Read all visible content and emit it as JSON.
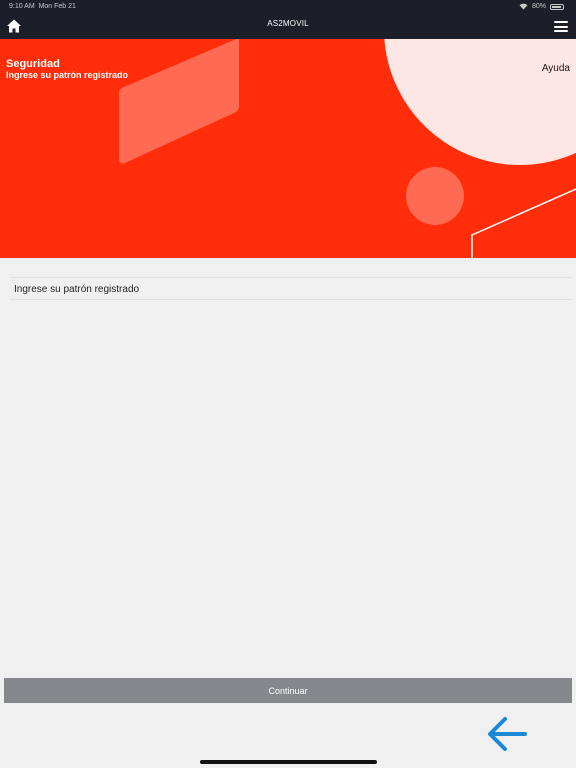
{
  "status_bar": {
    "time": "9:10 AM",
    "date": "Mon Feb 21",
    "battery": "80%",
    "wifi_icon": "wifi-icon",
    "battery_icon": "battery-icon"
  },
  "nav": {
    "title": "AS2MOVIL",
    "home_icon": "home-icon",
    "menu_icon": "hamburger-menu-icon"
  },
  "banner": {
    "title": "Seguridad",
    "subtitle": "Ingrese su patrón registrado",
    "help_link": "Ayuda",
    "colors": {
      "background": "#ff2d0a",
      "accent_light": "#fde6e3"
    }
  },
  "pattern_field": {
    "label": "Ingrese su patrón registrado"
  },
  "footer": {
    "continue_label": "Continuar",
    "back_icon": "arrow-left-icon",
    "colors": {
      "button": "#86878c",
      "back_arrow": "#1a8ad6"
    }
  }
}
